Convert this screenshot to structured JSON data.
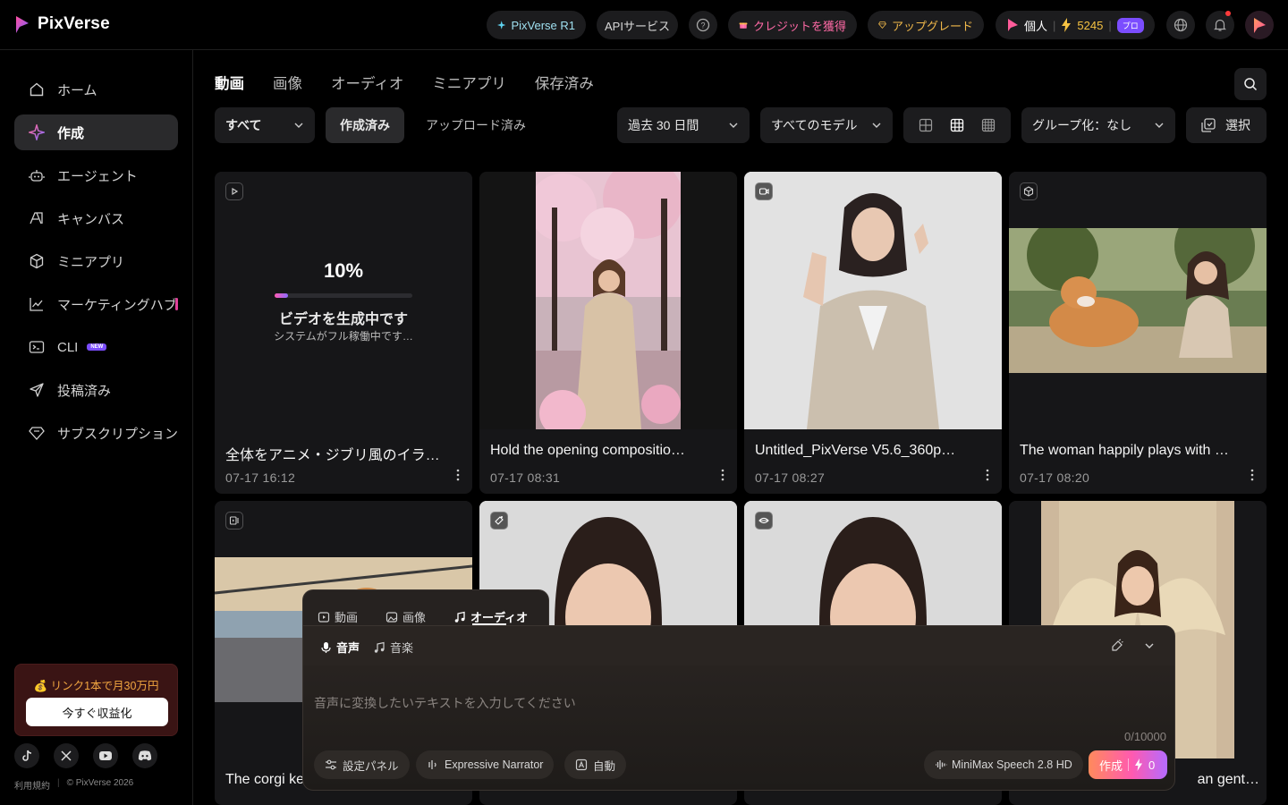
{
  "app": {
    "name": "PixVerse"
  },
  "header": {
    "r1_label": "PixVerse R1",
    "api_label": "APIサービス",
    "credit_label": "クレジットを獲得",
    "upgrade_label": "アップグレード",
    "account_type": "個人",
    "credits": "5245",
    "plan_badge": "プロ"
  },
  "sidebar": {
    "items": [
      {
        "label": "ホーム",
        "icon": "home-icon"
      },
      {
        "label": "作成",
        "icon": "sparkle-icon",
        "active": true
      },
      {
        "label": "エージェント",
        "icon": "robot-icon"
      },
      {
        "label": "キャンバス",
        "icon": "canvas-icon"
      },
      {
        "label": "ミニアプリ",
        "icon": "cube-icon"
      },
      {
        "label": "マーケティングハブ",
        "icon": "chart-icon"
      },
      {
        "label": "CLI",
        "icon": "terminal-icon",
        "badge": "NEW"
      },
      {
        "label": "投稿済み",
        "icon": "send-icon"
      },
      {
        "label": "サブスクリプション",
        "icon": "diamond-icon"
      }
    ],
    "promo": {
      "text": "💰 リンク1本で月30万円",
      "button": "今すぐ収益化"
    },
    "footer": {
      "terms": "利用規約",
      "copyright": "© PixVerse 2026"
    }
  },
  "main": {
    "tabs": [
      "動画",
      "画像",
      "オーディオ",
      "ミニアプリ",
      "保存済み"
    ],
    "filters": {
      "scope": "すべて",
      "created": "作成済み",
      "uploaded": "アップロード済み",
      "period": "過去 30 日間",
      "model": "すべてのモデル",
      "group": "グループ化：なし",
      "select": "選択"
    },
    "cards": [
      {
        "title": "全体をアニメ・ジブリ風のイラ…",
        "date": "07-17  16:12",
        "progress": "10%",
        "progress_value": 0.1,
        "status": "ビデオを生成中です",
        "substatus": "システムがフル稼働中です…"
      },
      {
        "title": "Hold the opening compositio…",
        "date": "07-17  08:31"
      },
      {
        "title": "Untitled_PixVerse V5.6_360p…",
        "date": "07-17  08:27"
      },
      {
        "title": "The woman happily plays with …",
        "date": "07-17  08:20"
      },
      {
        "title": "The corgi ke"
      },
      {
        "title": ""
      },
      {
        "title": ""
      },
      {
        "title": "an gent…"
      }
    ]
  },
  "composer": {
    "tabs": [
      "動画",
      "画像",
      "オーディオ"
    ],
    "subtabs": [
      "音声",
      "音楽"
    ],
    "placeholder": "音声に変換したいテキストを入力してください",
    "counter": "0/10000",
    "settings": "設定パネル",
    "voice": "Expressive Narrator",
    "auto": "自動",
    "model": "MiniMax Speech 2.8 HD",
    "create": "作成",
    "cost": "0"
  }
}
